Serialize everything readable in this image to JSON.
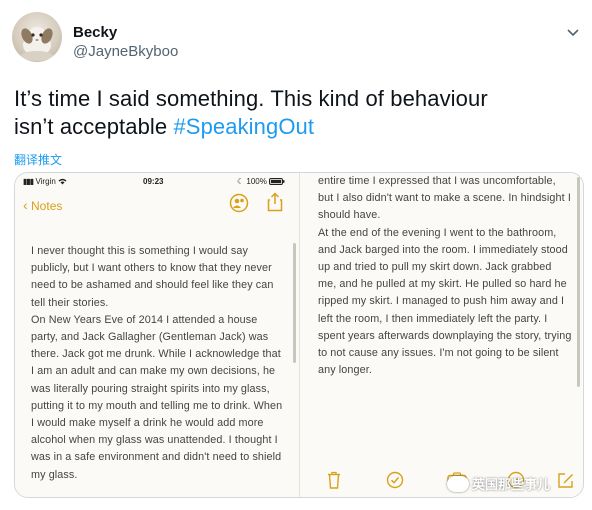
{
  "user": {
    "name": "Becky",
    "handle": "@JayneBkyboo"
  },
  "tweet": {
    "text_line1": "It’s time I said something. This kind of behaviour",
    "text_line2_prefix": "isn’t acceptable ",
    "hashtag": "#SpeakingOut",
    "translate_label": "翻译推文"
  },
  "left_phone": {
    "carrier": "Virgin",
    "time": "09:23",
    "battery": "100%",
    "back_label": "Notes",
    "paragraphs": [
      "I never thought this is something I would say publicly, but I want others to know that they never need to be ashamed and should feel like they can tell their stories.",
      "On New Years Eve of 2014 I attended a house party, and Jack Gallagher (Gentleman Jack) was there. Jack got me drunk. While I acknowledge that I am an adult and can make my own decisions, he was literally pouring straight spirits into my glass, putting it to my mouth and telling me to drink. When I would make myself a drink he would add more alcohol when my glass was unattended. I thought I was in a safe environment and didn't need to shield my glass."
    ]
  },
  "right_phone": {
    "paragraphs": [
      "entire time I expressed that I was uncomfortable, but I also didn't want to make a scene. In hindsight I should have.",
      "At the end of the evening I went to the bathroom, and Jack barged into the room. I immediately stood up and tried to pull my skirt down. Jack grabbed me, and he pulled at my skirt. He pulled so hard he ripped my skirt. I managed to push him away and I left the room, I then immediately left the party. I spent years afterwards downplaying the story, trying to not cause any issues. I'm not going to be silent any longer."
    ]
  },
  "watermark": {
    "text": "英国那些事儿"
  },
  "colors": {
    "hashtag": "#1d9bf0",
    "notes_accent": "#d7a21a"
  },
  "icons": [
    "avatar",
    "chevron-down-icon",
    "wifi-icon",
    "moon-icon",
    "battery-icon",
    "back-chevron-icon",
    "collaborate-icon",
    "share-icon",
    "trash-icon",
    "checklist-icon",
    "camera-icon",
    "markup-icon",
    "compose-icon"
  ]
}
